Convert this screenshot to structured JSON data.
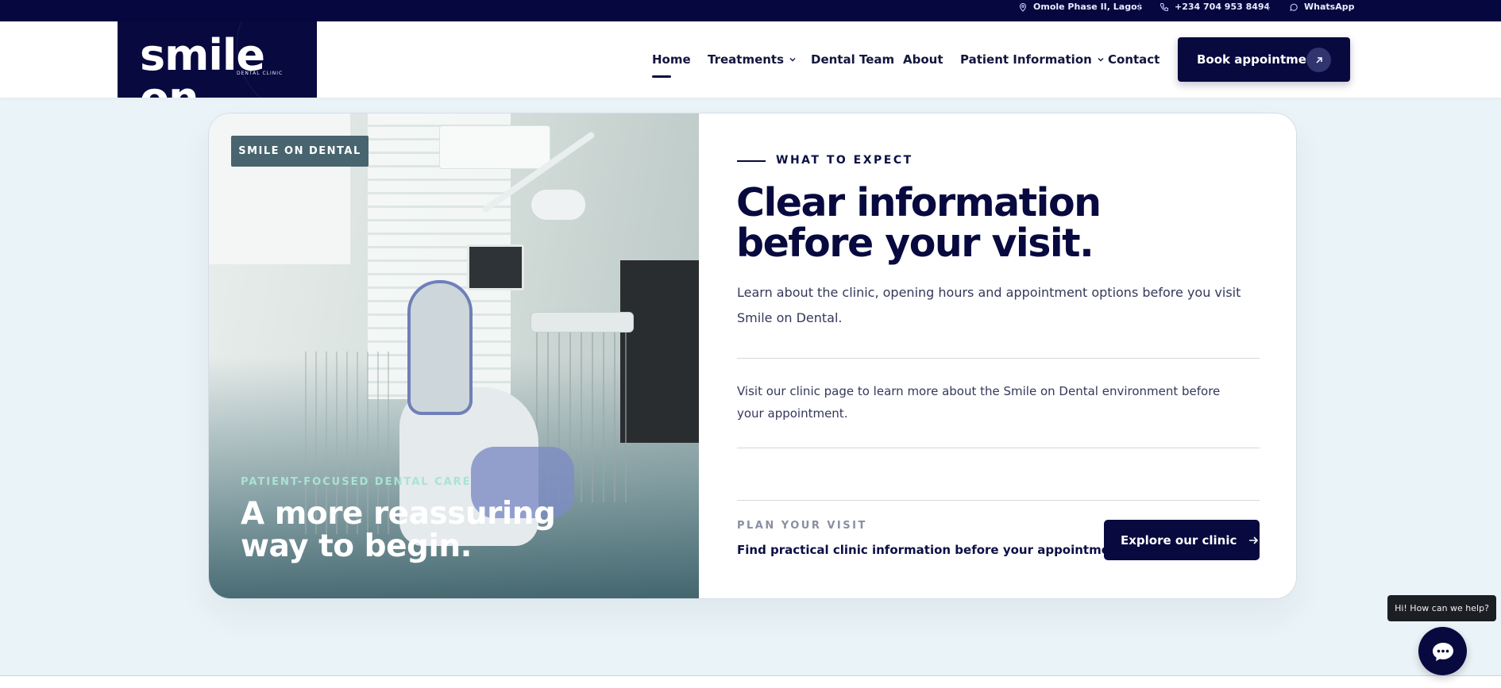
{
  "topbar": {
    "location": "Omole Phase II, Lagos",
    "phone": "+234 704 953 8494",
    "whatsapp": "WhatsApp"
  },
  "logo": {
    "text": "smile on",
    "subtext": "DENTAL CLINIC"
  },
  "nav": {
    "home": "Home",
    "treatments": "Treatments",
    "dental_team": "Dental Team",
    "about": "About",
    "patient_information": "Patient Information",
    "contact": "Contact",
    "active": "Home"
  },
  "book_button": "Book appointment",
  "photo_panel": {
    "badge": "SMILE ON DENTAL",
    "eyebrow": "PATIENT-FOCUSED DENTAL CARE",
    "title": "A more reassuring way to begin."
  },
  "info_panel": {
    "kicker": "WHAT TO EXPECT",
    "heading_line1": "Clear information",
    "heading_line2": "before your visit.",
    "lead": "Learn about the clinic, opening hours and appointment options before you visit Smile on Dental.",
    "paragraph": "Visit our clinic page to learn more about the Smile on Dental environment before your appointment.",
    "plan_kicker": "PLAN YOUR VISIT",
    "plan_text": "Find practical clinic information before your appointment.",
    "explore_button": "Explore our clinic"
  },
  "chat": {
    "bubble": "Hi! How can we help?"
  },
  "colors": {
    "navy": "#07093f",
    "teal_badge": "#48646e",
    "mint": "#a9e3d3",
    "page_bg": "#eaf3f7"
  },
  "icons": [
    "map-pin-icon",
    "phone-icon",
    "whatsapp-icon",
    "chevron-down-icon",
    "arrow-up-right-icon",
    "arrow-right-icon",
    "chat-icon"
  ]
}
